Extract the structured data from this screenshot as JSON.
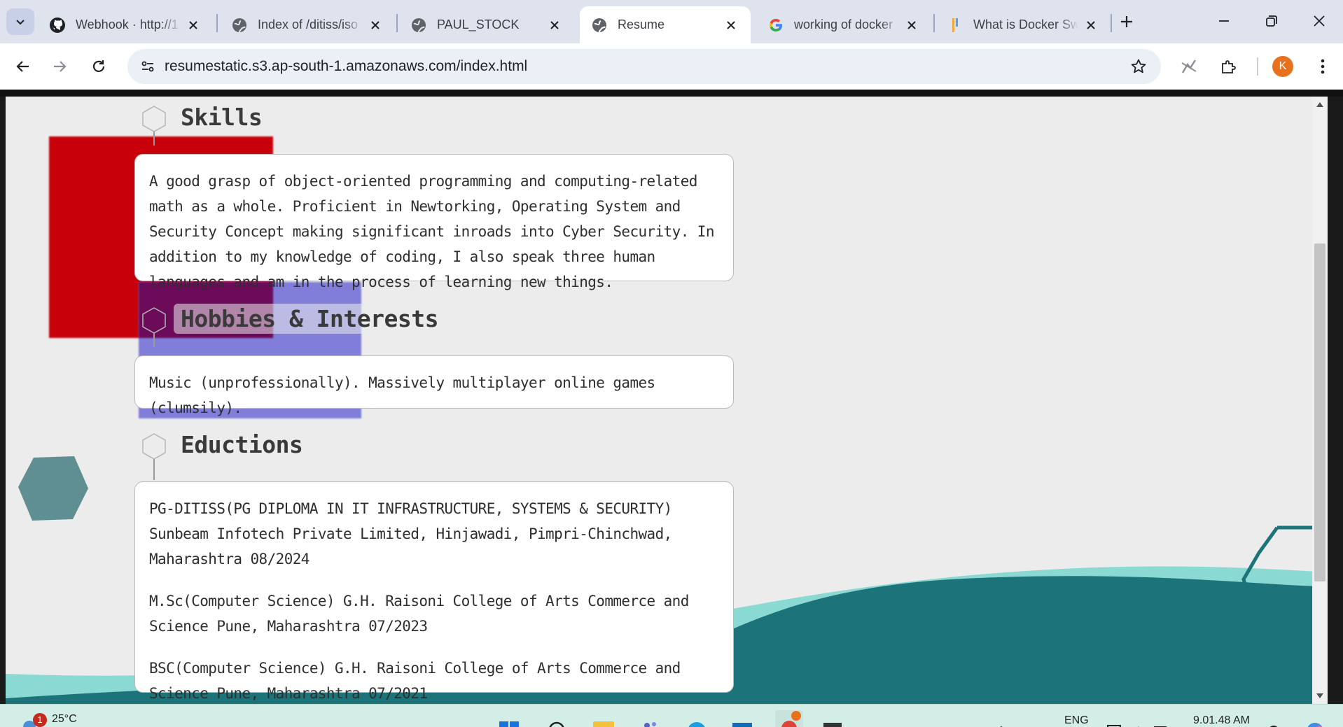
{
  "browser": {
    "tabs": [
      {
        "title": "Webhook · http://1",
        "icon": "github-icon"
      },
      {
        "title": "Index of /ditiss/iso",
        "icon": "globe-icon"
      },
      {
        "title": "PAUL_STOCK",
        "icon": "globe-icon"
      },
      {
        "title": "Resume",
        "icon": "globe-icon",
        "active": true
      },
      {
        "title": "working of docker",
        "icon": "google-icon"
      },
      {
        "title": "What is Docker Sw",
        "icon": "bookmark-bars-icon"
      }
    ],
    "url": "resumestatic.s3.ap-south-1.amazonaws.com/index.html",
    "profile_initial": "K"
  },
  "page": {
    "sections": {
      "skills": {
        "title": "Skills",
        "body": "A good grasp of object-oriented programming and computing-related math as a whole. Proficient in Newtorking, Operating System and Security Concept making significant inroads into Cyber Security. In addition to my knowledge of coding, I also speak three human languages and am in the process of learning new things."
      },
      "hobbies": {
        "title": "Hobbies & Interests",
        "body": "Music (unprofessionally). Massively multiplayer online games (clumsily)."
      },
      "education": {
        "title": "Eductions",
        "entries": [
          "PG-DITISS(PG DIPLOMA IN IT INFRASTRUCTURE, SYSTEMS & SECURITY) Sunbeam Infotech Private Limited, Hinjawadi, Pimpri-Chinchwad, Maharashtra 08/2024",
          "M.Sc(Computer Science) G.H. Raisoni College of Arts Commerce and Science Pune, Maharashtra 07/2023",
          "BSC(Computer Science) G.H. Raisoni College of Arts Commerce and Science Pune, Maharashtra 07/2021"
        ]
      }
    },
    "colors": {
      "red_block": "#c8000a",
      "purple_block": "#7b79d8",
      "wave_dark": "#1c7379",
      "wave_light": "#8ad9d3",
      "hexagon": "#5f8f92"
    }
  },
  "taskbar": {
    "weather": "25°C",
    "notification_count": "1",
    "language": "ENG",
    "time": "9.01.48 AM"
  }
}
